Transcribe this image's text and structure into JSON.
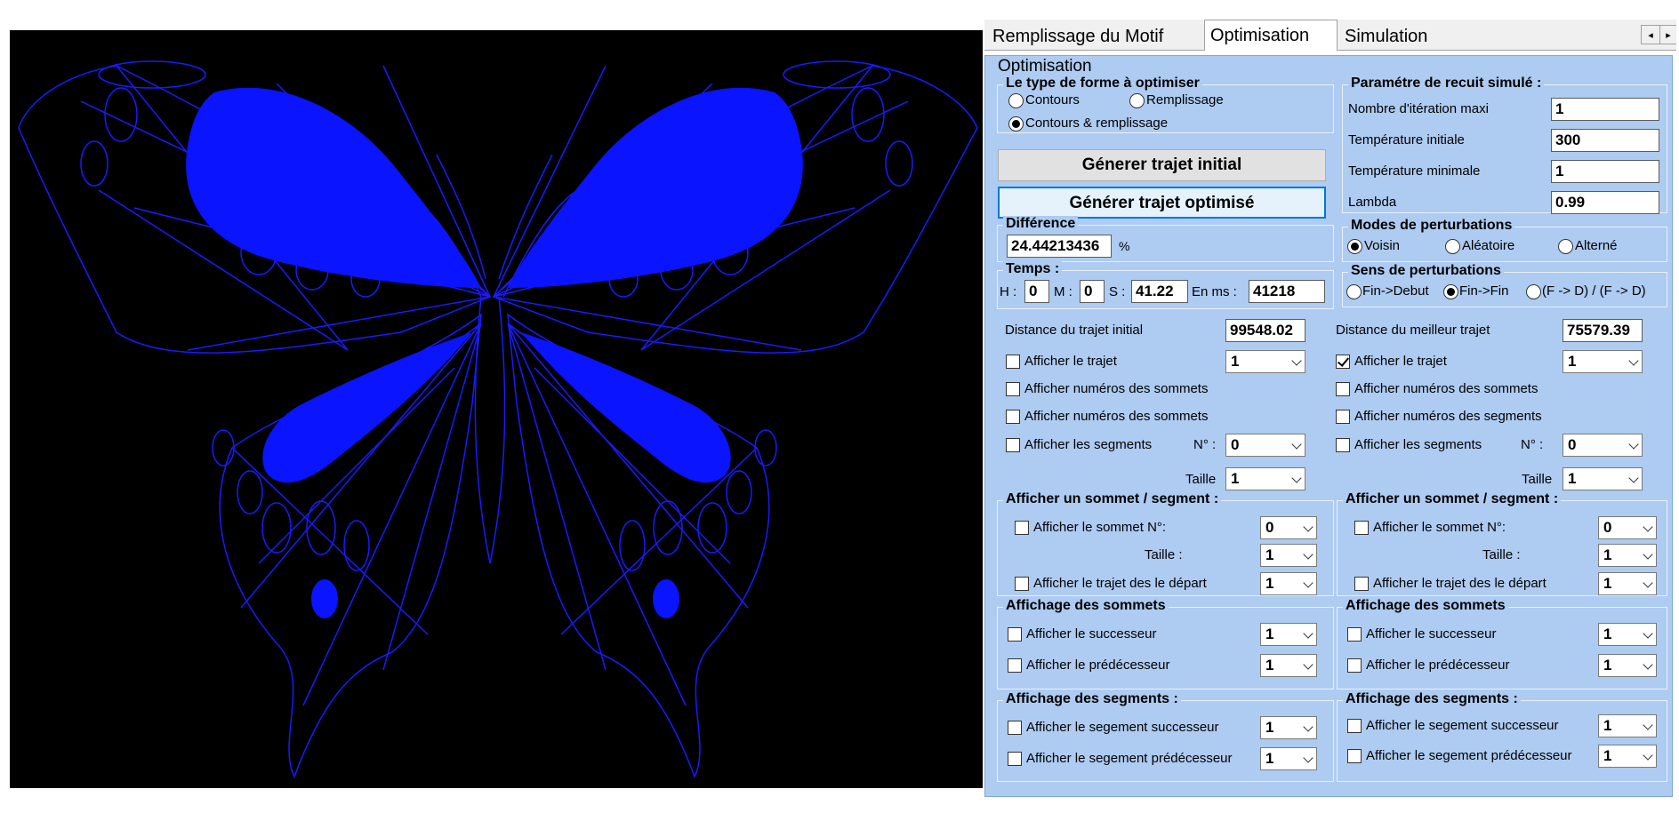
{
  "tabs": [
    "Remplissage du Motif",
    "Optimisation",
    "Simulation"
  ],
  "tab_scroll": {
    "left": "◂",
    "right": "▸"
  },
  "section_title": "Optimisation",
  "shape_type": {
    "title": "Le type de forme à optimiser",
    "options": [
      "Contours",
      "Remplissage",
      "Contours & remplissage"
    ],
    "selected": "Contours & remplissage"
  },
  "buttons": {
    "initial": "Génerer trajet initial",
    "optimized": "Générer trajet optimisé"
  },
  "difference": {
    "title": "Différence",
    "value": "24.44213436",
    "unit": "%"
  },
  "temps": {
    "title": "Temps :",
    "h_label": "H :",
    "h": "0",
    "m_label": "M :",
    "m": "0",
    "s_label": "S :",
    "s": "41.22",
    "ms_label": "En ms :",
    "ms": "41218"
  },
  "recuit": {
    "title": "Paramétre de recuit simulé :",
    "params": [
      {
        "label": "Nombre d'itération maxi",
        "value": "1"
      },
      {
        "label": "Température initiale",
        "value": "300"
      },
      {
        "label": "Température minimale",
        "value": "1"
      },
      {
        "label": "Lambda",
        "value": "0.99"
      }
    ]
  },
  "modes": {
    "title": "Modes de perturbations",
    "options": [
      "Voisin",
      "Aléatoire",
      "Alterné"
    ],
    "selected": "Voisin"
  },
  "sens": {
    "title": "Sens de perturbations",
    "options": [
      "Fin->Debut",
      "Fin->Fin",
      "(F -> D) / (F -> D)"
    ],
    "selected": "Fin->Fin"
  },
  "left": {
    "distance_label": "Distance du trajet initial",
    "distance": "99548.02",
    "afficher_trajet": {
      "label": "Afficher le trajet",
      "checked": false,
      "value": "1"
    },
    "num_sommets": "Afficher numéros des sommets",
    "num_segments": "Afficher numéros des sommets",
    "segments": {
      "label": "Afficher les segments",
      "n_label": "N° :",
      "value": "0"
    },
    "taille": {
      "label": "Taille",
      "value": "1"
    },
    "un_sommet": {
      "title": "Afficher un sommet / segment :",
      "sommet_label": "Afficher le sommet N°:",
      "sommet_value": "0",
      "taille_label": "Taille :",
      "taille_value": "1",
      "depart_label": "Afficher le trajet des le départ",
      "depart_value": "1"
    },
    "aff_sommets": {
      "title": "Affichage des sommets",
      "succ": "Afficher le successeur",
      "succ_v": "1",
      "pred": "Afficher le prédécesseur",
      "pred_v": "1"
    },
    "aff_segments": {
      "title": "Affichage des segments :",
      "succ": "Afficher le segement successeur",
      "succ_v": "1",
      "pred": "Afficher le segement prédécesseur",
      "pred_v": "1"
    }
  },
  "right": {
    "distance_label": "Distance du meilleur trajet",
    "distance": "75579.39",
    "afficher_trajet": {
      "label": "Afficher le trajet",
      "checked": true,
      "value": "1"
    },
    "num_sommets": "Afficher numéros des sommets",
    "num_segments": "Afficher numéros des segments",
    "segments": {
      "label": "Afficher les segments",
      "n_label": "N° :",
      "value": "0"
    },
    "taille": {
      "label": "Taille",
      "value": "1"
    },
    "un_sommet": {
      "title": "Afficher un sommet / segment :",
      "sommet_label": "Afficher le sommet N°:",
      "sommet_value": "0",
      "taille_label": "Taille :",
      "taille_value": "1",
      "depart_label": "Afficher le trajet des le départ",
      "depart_value": "1"
    },
    "aff_sommets": {
      "title": "Affichage des sommets",
      "succ": "Afficher le successeur",
      "succ_v": "1",
      "pred": "Afficher le prédécesseur",
      "pred_v": "1"
    },
    "aff_segments": {
      "title": "Affichage des segments :",
      "succ": "Afficher le segement successeur",
      "succ_v": "1",
      "pred": "Afficher le segement prédécesseur",
      "pred_v": "1"
    }
  },
  "colors": {
    "canvas_bg": "#000000",
    "path_stroke": "#1a1aff",
    "fill": "#0a14ff",
    "panel_bg": "#aecbf1"
  }
}
